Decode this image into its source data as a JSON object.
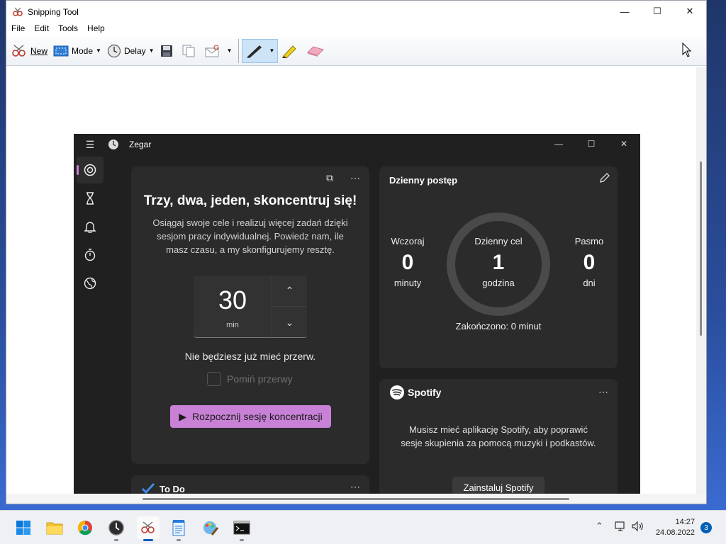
{
  "snipping_tool": {
    "title": "Snipping Tool",
    "menu": [
      "File",
      "Edit",
      "Tools",
      "Help"
    ],
    "toolbar": {
      "new": "New",
      "mode": "Mode",
      "delay": "Delay"
    }
  },
  "clock_app": {
    "title": "Zegar",
    "focus": {
      "heading": "Trzy, dwa, jeden, skoncentruj się!",
      "description": "Osiągaj swoje cele i realizuj więcej zadań dzięki sesjom pracy indywidualnej. Powiedz nam, ile masz czasu, a my skonfigurujemy resztę.",
      "timer_value": "30",
      "timer_unit": "min",
      "no_breaks": "Nie będziesz już mieć przerw.",
      "skip_breaks": "Pomiń przerwy",
      "start_button": "Rozpocznij sesję koncentracji"
    },
    "daily": {
      "title": "Dzienny postęp",
      "yesterday_label": "Wczoraj",
      "yesterday_value": "0",
      "yesterday_unit": "minuty",
      "goal_label": "Dzienny cel",
      "goal_value": "1",
      "goal_unit": "godzina",
      "streak_label": "Pasmo",
      "streak_value": "0",
      "streak_unit": "dni",
      "completed": "Zakończono: 0 minut"
    },
    "spotify": {
      "title": "Spotify",
      "message": "Musisz mieć aplikację Spotify, aby poprawić sesje skupienia za pomocą muzyki i podkastów.",
      "install_button": "Zainstaluj Spotify"
    },
    "todo": {
      "title": "To Do"
    }
  },
  "taskbar": {
    "time": "14:27",
    "date": "24.08.2022",
    "notifications": "3"
  },
  "colors": {
    "accent": "#c881d6",
    "dark_bg": "#202020",
    "card_bg": "#2b2b2b",
    "taskbar_accent": "#005fb8"
  }
}
